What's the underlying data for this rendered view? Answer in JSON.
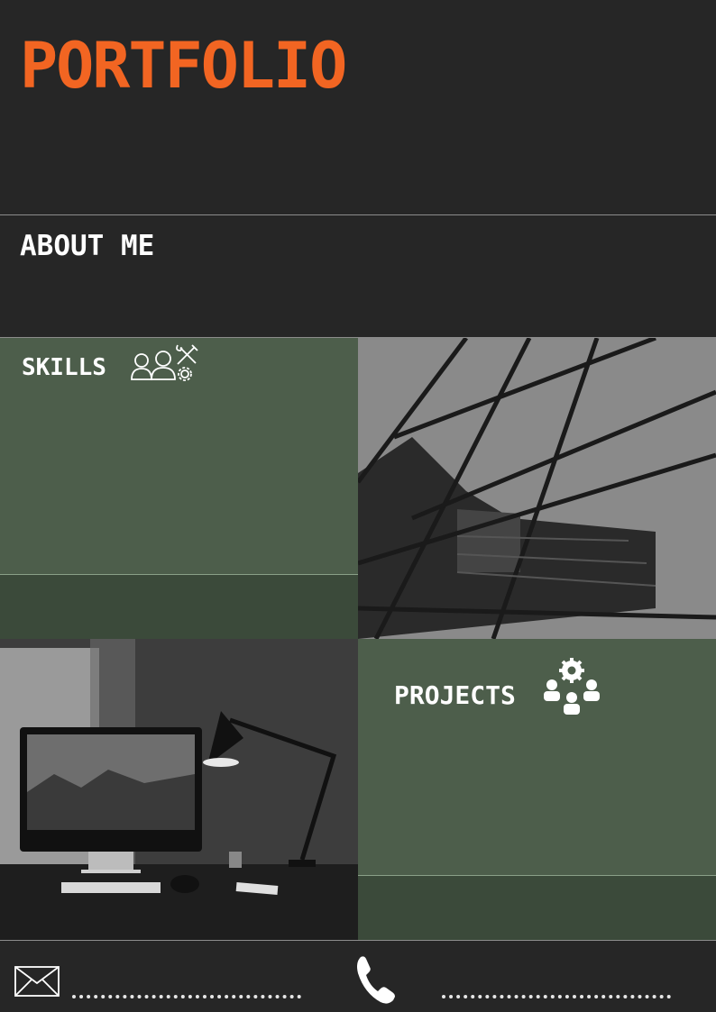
{
  "header": {
    "title": "PORTFOLIO"
  },
  "about": {
    "title": "ABOUT ME"
  },
  "skills": {
    "title": "SKILLS",
    "icon": "team-tools-icon"
  },
  "projects": {
    "title": "PROJECTS",
    "icon": "team-gear-icon"
  },
  "images": {
    "building": "building-photo",
    "desk": "desk-workspace-photo"
  },
  "footer": {
    "email_icon": "email-icon",
    "phone_icon": "phone-icon"
  },
  "colors": {
    "accent": "#f26522",
    "panel_green": "#4d5e4b",
    "panel_green_dark": "#3b4a3a",
    "background": "#262626"
  }
}
